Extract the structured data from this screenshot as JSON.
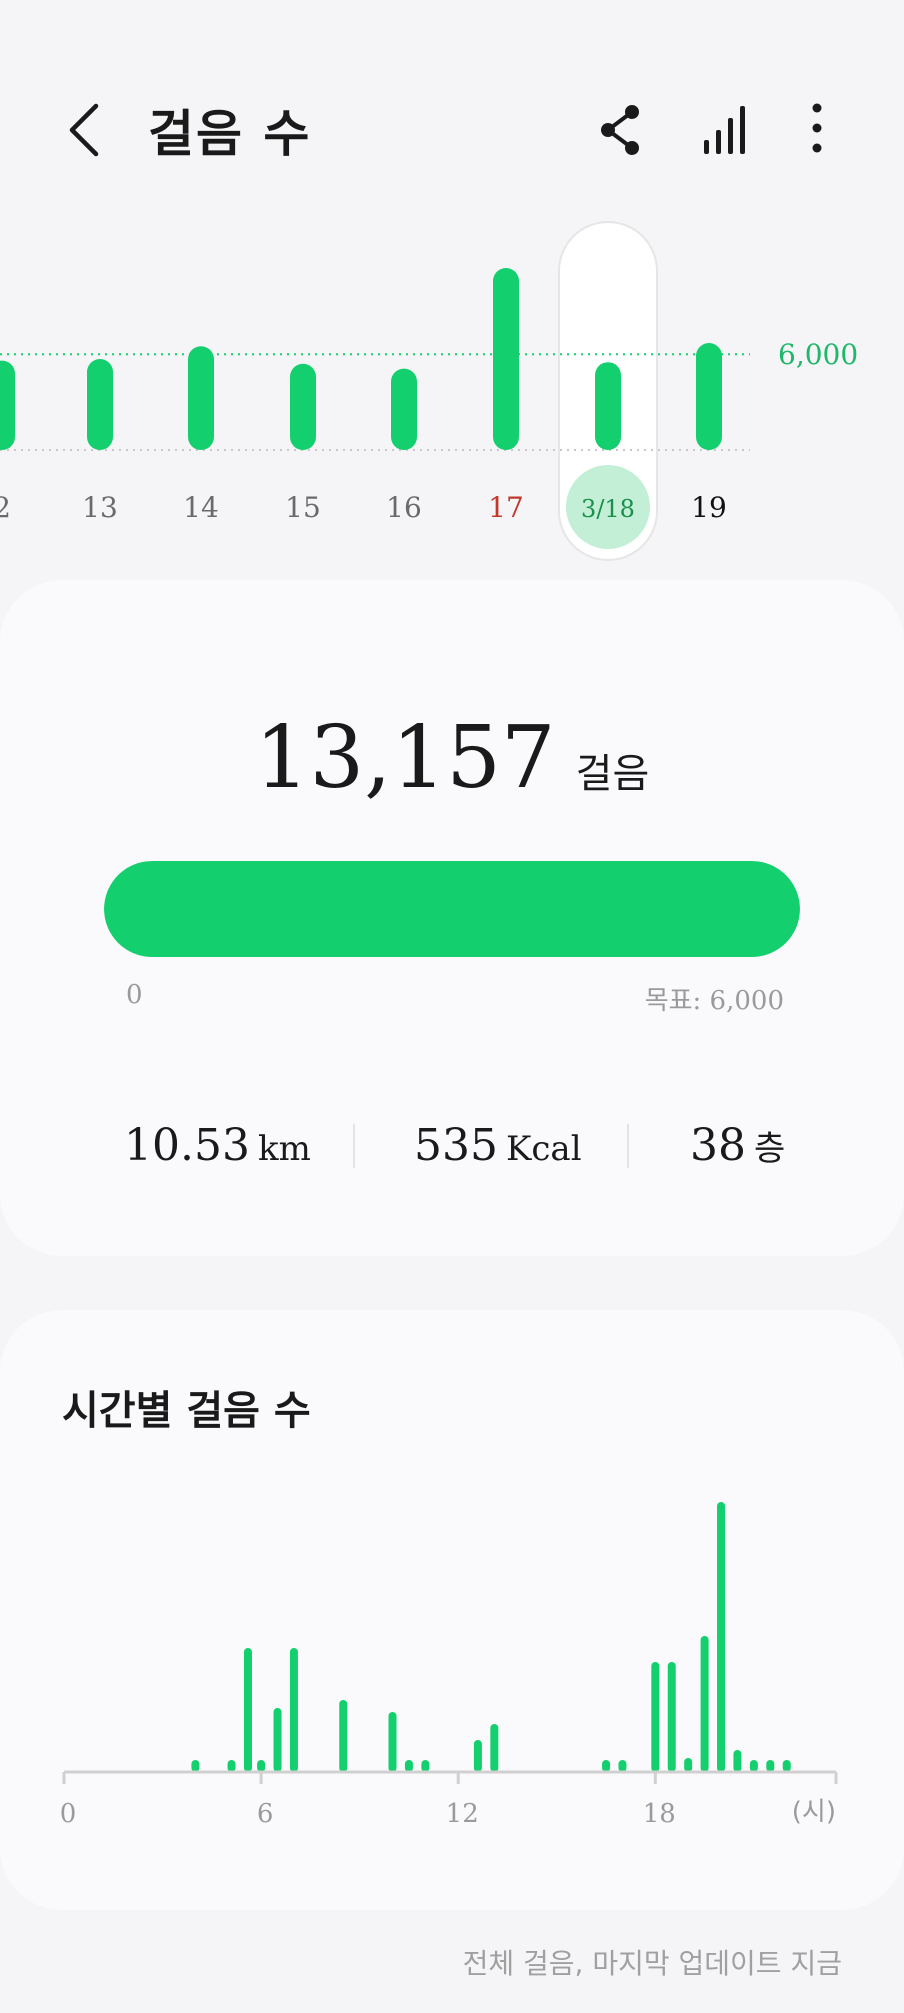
{
  "header": {
    "title": "걸음 수",
    "icons": [
      "back-arrow-icon",
      "share-icon",
      "chart-bars-icon",
      "more-vert-icon"
    ]
  },
  "daily": {
    "days": [
      "2",
      "13",
      "14",
      "15",
      "16",
      "17",
      "3/18",
      "19"
    ],
    "values": [
      5600,
      5700,
      6500,
      5400,
      5100,
      11400,
      5500,
      6700
    ],
    "selected_index": 6,
    "holiday_index": 5,
    "goal_line_label": "6,000",
    "goal": 6000
  },
  "summary": {
    "steps": "13,157",
    "steps_unit": "걸음",
    "progress_min": "0",
    "progress_goal": "목표: 6,000",
    "progress_fraction": 1.0,
    "distance": "10.53",
    "distance_unit": "km",
    "calories": "535",
    "calories_unit": "Kcal",
    "floors": "38",
    "floors_unit": "층"
  },
  "hourly": {
    "title": "시간별 걸음 수",
    "x_ticks": [
      "0",
      "6",
      "12",
      "18"
    ],
    "x_unit": "(시)",
    "bars": [
      {
        "x": 4.0,
        "v": 6
      },
      {
        "x": 5.1,
        "v": 6
      },
      {
        "x": 5.6,
        "v": 62
      },
      {
        "x": 6.0,
        "v": 6
      },
      {
        "x": 6.5,
        "v": 32
      },
      {
        "x": 7.0,
        "v": 62
      },
      {
        "x": 8.5,
        "v": 36
      },
      {
        "x": 10.0,
        "v": 30
      },
      {
        "x": 10.5,
        "v": 6
      },
      {
        "x": 11.0,
        "v": 6
      },
      {
        "x": 12.6,
        "v": 16
      },
      {
        "x": 13.1,
        "v": 24
      },
      {
        "x": 16.5,
        "v": 6
      },
      {
        "x": 17.0,
        "v": 6
      },
      {
        "x": 18.0,
        "v": 55
      },
      {
        "x": 18.5,
        "v": 55
      },
      {
        "x": 19.0,
        "v": 7
      },
      {
        "x": 19.5,
        "v": 68
      },
      {
        "x": 20.0,
        "v": 135
      },
      {
        "x": 20.5,
        "v": 11
      },
      {
        "x": 21.0,
        "v": 6
      },
      {
        "x": 21.5,
        "v": 6
      },
      {
        "x": 22.0,
        "v": 6
      }
    ],
    "x_max": 23.5
  },
  "footer": {
    "text": "전체 걸음, 마지막 업데이트 지금"
  },
  "colors": {
    "accent": "#14cf6d",
    "accent_text": "#1fb86a",
    "holiday": "#c0392b",
    "selected_bg": "#c3efd7"
  }
}
